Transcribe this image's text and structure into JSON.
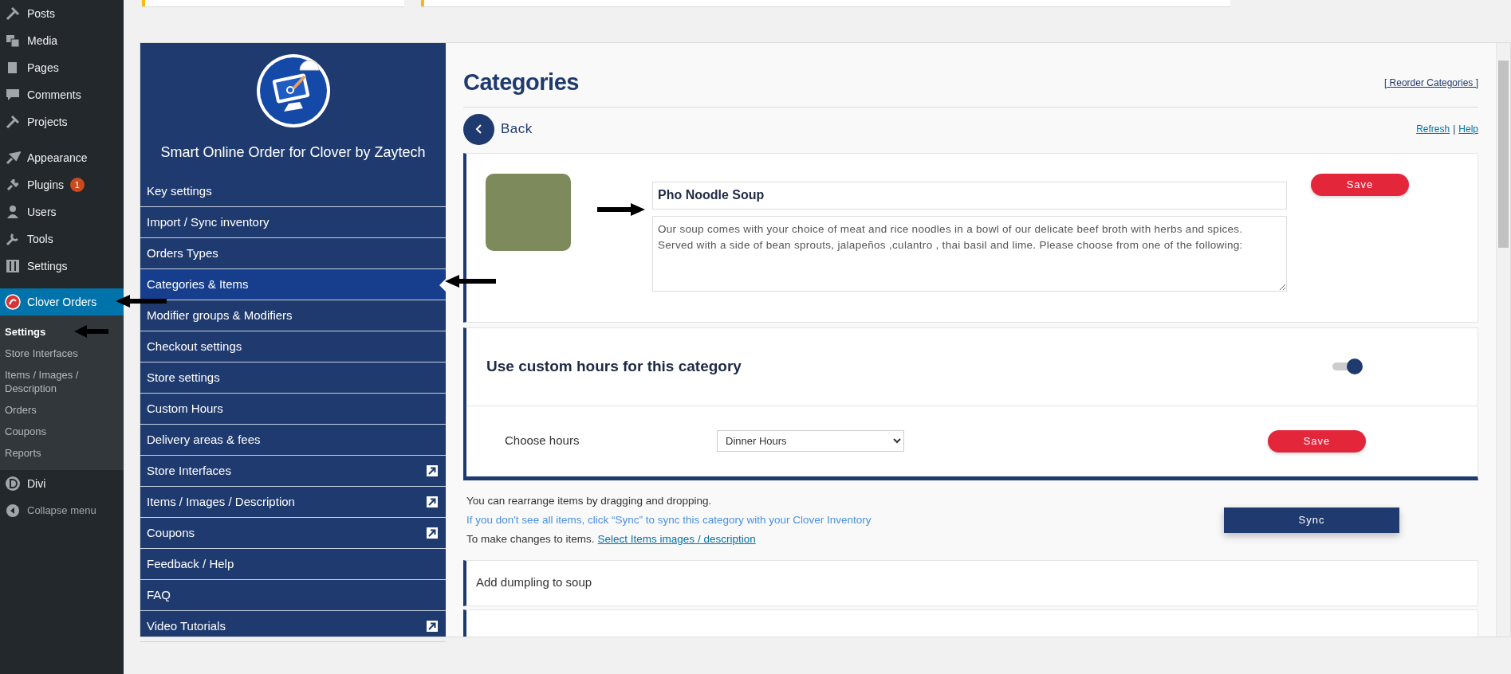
{
  "admin_menu": {
    "groups": [
      [
        {
          "label": "Posts",
          "selected": false
        },
        {
          "label": "Media",
          "selected": false
        },
        {
          "label": "Pages",
          "selected": false
        },
        {
          "label": "Comments",
          "selected": false
        },
        {
          "label": "Projects",
          "selected": false
        }
      ],
      [
        {
          "label": "Appearance",
          "selected": false
        },
        {
          "label": "Plugins",
          "selected": false,
          "badge": "1"
        },
        {
          "label": "Users",
          "selected": false
        },
        {
          "label": "Tools",
          "selected": false
        },
        {
          "label": "Settings",
          "selected": false
        }
      ],
      [
        {
          "label": "Clover Orders",
          "selected": true,
          "submenu": [
            {
              "label": "Settings",
              "selected": true
            },
            {
              "label": "Store Interfaces",
              "selected": false
            },
            {
              "label": "Items / Images / Description",
              "selected": false
            },
            {
              "label": "Orders",
              "selected": false
            },
            {
              "label": "Coupons",
              "selected": false
            },
            {
              "label": "Reports",
              "selected": false
            }
          ]
        },
        {
          "label": "Divi",
          "selected": false
        }
      ]
    ],
    "collapse_label": "Collapse menu"
  },
  "plugin_nav": {
    "title": "Smart Online Order for Clover by Zaytech",
    "items": [
      {
        "label": "Key settings",
        "selected": false,
        "external": false
      },
      {
        "label": "Import / Sync inventory",
        "selected": false,
        "external": false
      },
      {
        "label": "Orders Types",
        "selected": false,
        "external": false
      },
      {
        "label": "Categories & Items",
        "selected": true,
        "external": false
      },
      {
        "label": "Modifier groups & Modifiers",
        "selected": false,
        "external": false
      },
      {
        "label": "Checkout settings",
        "selected": false,
        "external": false
      },
      {
        "label": "Store settings",
        "selected": false,
        "external": false
      },
      {
        "label": "Custom Hours",
        "selected": false,
        "external": false
      },
      {
        "label": "Delivery areas & fees",
        "selected": false,
        "external": false
      },
      {
        "label": "Store Interfaces",
        "selected": false,
        "external": true
      },
      {
        "label": "Items / Images / Description",
        "selected": false,
        "external": true
      },
      {
        "label": "Coupons",
        "selected": false,
        "external": true
      },
      {
        "label": "Feedback / Help",
        "selected": false,
        "external": false
      },
      {
        "label": "FAQ",
        "selected": false,
        "external": false
      },
      {
        "label": "Video Tutorials",
        "selected": false,
        "external": true
      }
    ]
  },
  "content": {
    "page_title": "Categories",
    "reorder_link": "[ Reorder Categories ]",
    "back_label": "Back",
    "refresh_link": "Refresh",
    "link_separator": "|",
    "help_link": "Help",
    "category": {
      "name": "Pho Noodle Soup",
      "description": "Our soup comes with your choice of meat and rice noodles in a bowl of our delicate beef broth with herbs and spices. Served with a side of bean sprouts, jalapeños ,culantro , thai basil and lime. Please choose from one of the following:",
      "save_label": "Save"
    },
    "custom_hours": {
      "label": "Use custom hours for this category",
      "on": true,
      "choose_label": "Choose hours",
      "selected_hours": "Dinner Hours",
      "save_label": "Save"
    },
    "info_lines": [
      {
        "kind": "plain",
        "text": "You can rearrange items by dragging and dropping."
      },
      {
        "kind": "hint",
        "text": "If you don't see all items, click “Sync” to sync this category with your Clover Inventory"
      },
      {
        "kind": "link",
        "text": "To make changes to items.",
        "link": "Select Items images / description"
      }
    ],
    "sync_label": "Sync",
    "items": [
      {
        "label": "Add dumpling to soup"
      }
    ]
  }
}
